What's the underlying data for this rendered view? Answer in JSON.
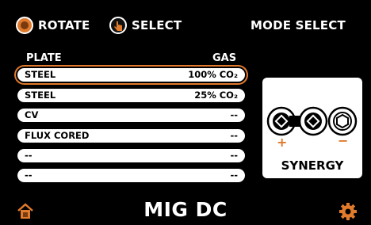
{
  "header": {
    "rotate_label": "ROTATE",
    "select_label": "SELECT",
    "mode_label": "MODE SELECT"
  },
  "table": {
    "col_plate": "PLATE",
    "col_gas": "GAS",
    "rows": [
      {
        "plate": "STEEL",
        "gas": "100% CO₂",
        "selected": true
      },
      {
        "plate": "STEEL",
        "gas": "25% CO₂",
        "selected": false
      },
      {
        "plate": "CV",
        "gas": "--",
        "selected": false
      },
      {
        "plate": "FLUX CORED",
        "gas": "--",
        "selected": false
      },
      {
        "plate": "--",
        "gas": "--",
        "selected": false
      },
      {
        "plate": "--",
        "gas": "--",
        "selected": false
      }
    ]
  },
  "polarity_panel": {
    "plus": "+",
    "minus": "−",
    "label": "SYNERGY"
  },
  "footer": {
    "title": "MIG DC"
  },
  "colors": {
    "accent": "#e07a2c",
    "background": "#000000",
    "row": "#ffffff"
  },
  "icons": [
    "rotate-knob-icon",
    "press-select-icon",
    "home-icon",
    "settings-gear-icon",
    "terminal-socket-icon"
  ]
}
